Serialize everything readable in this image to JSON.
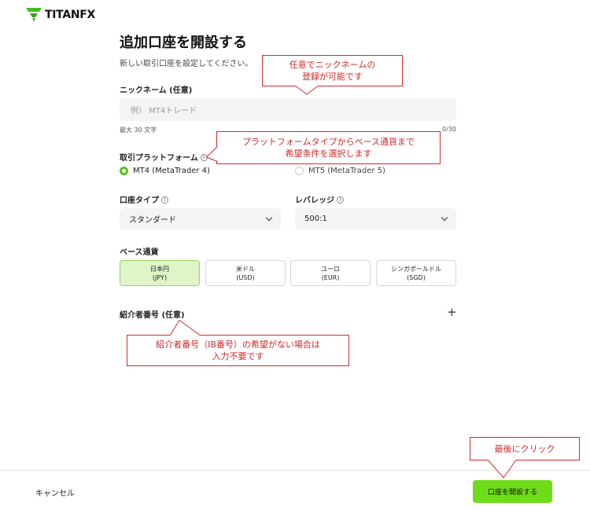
{
  "brand": {
    "logo_text": "TITANFX",
    "logo_icon": "titanfx-logo-icon",
    "accent": "#6fdc1a"
  },
  "page": {
    "title": "追加口座を開設する",
    "subtitle": "新しい取引口座を設定してください。"
  },
  "nickname": {
    "label": "ニックネーム (任意)",
    "placeholder": "例） MT4トレード",
    "hint": "最大 30 文字",
    "counter": "0/30"
  },
  "platform": {
    "label": "取引プラットフォーム",
    "options": [
      {
        "label": "MT4 (MetaTrader 4)",
        "selected": true
      },
      {
        "label": "MT5 (MetaTrader 5)",
        "selected": false
      }
    ]
  },
  "account_type": {
    "label": "口座タイプ",
    "value": "スタンダード"
  },
  "leverage": {
    "label": "レバレッジ",
    "value": "500:1"
  },
  "base_currency": {
    "label": "ベース通貨",
    "options": [
      {
        "name": "日本円",
        "code": "(JPY)",
        "selected": true
      },
      {
        "name": "米ドル",
        "code": "(USD)",
        "selected": false
      },
      {
        "name": "ユーロ",
        "code": "(EUR)",
        "selected": false
      },
      {
        "name": "シンガポールドル",
        "code": "(SGD)",
        "selected": false
      }
    ]
  },
  "referral": {
    "label": "紹介者番号 (任意)",
    "expand_icon": "plus-icon"
  },
  "footer": {
    "cancel_label": "キャンセル",
    "submit_label": "口座を開設する"
  },
  "annotations": {
    "nickname_note": [
      "任意でニックネームの",
      "登録が可能です"
    ],
    "platform_note": [
      "プラットフォームタイプからベース通貨まで",
      "希望条件を選択します"
    ],
    "referral_note": [
      "紹介者番号（IB番号）の希望がない場合は",
      "入力不要です"
    ],
    "submit_note": [
      "最後にクリック"
    ]
  }
}
